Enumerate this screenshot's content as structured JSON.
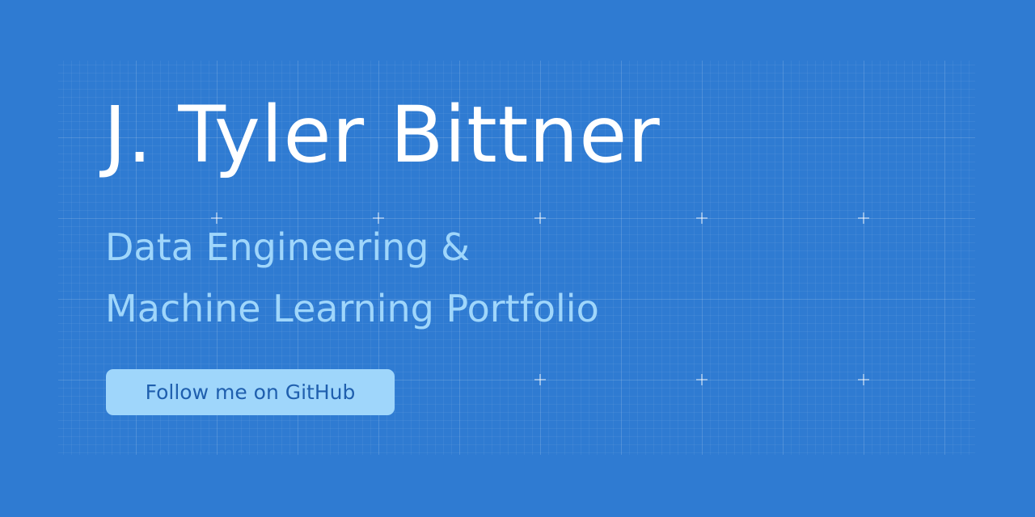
{
  "hero": {
    "title": "J. Tyler Bittner",
    "subtitle_line1": "Data Engineering &",
    "subtitle_line2": "Machine Learning Portfolio",
    "cta_label": "Follow me on GitHub"
  },
  "colors": {
    "background": "#2f7bd2",
    "title": "#ffffff",
    "subtitle": "#9fd6fb",
    "button_background": "#9fd6fb",
    "button_text": "#1f5fae"
  }
}
